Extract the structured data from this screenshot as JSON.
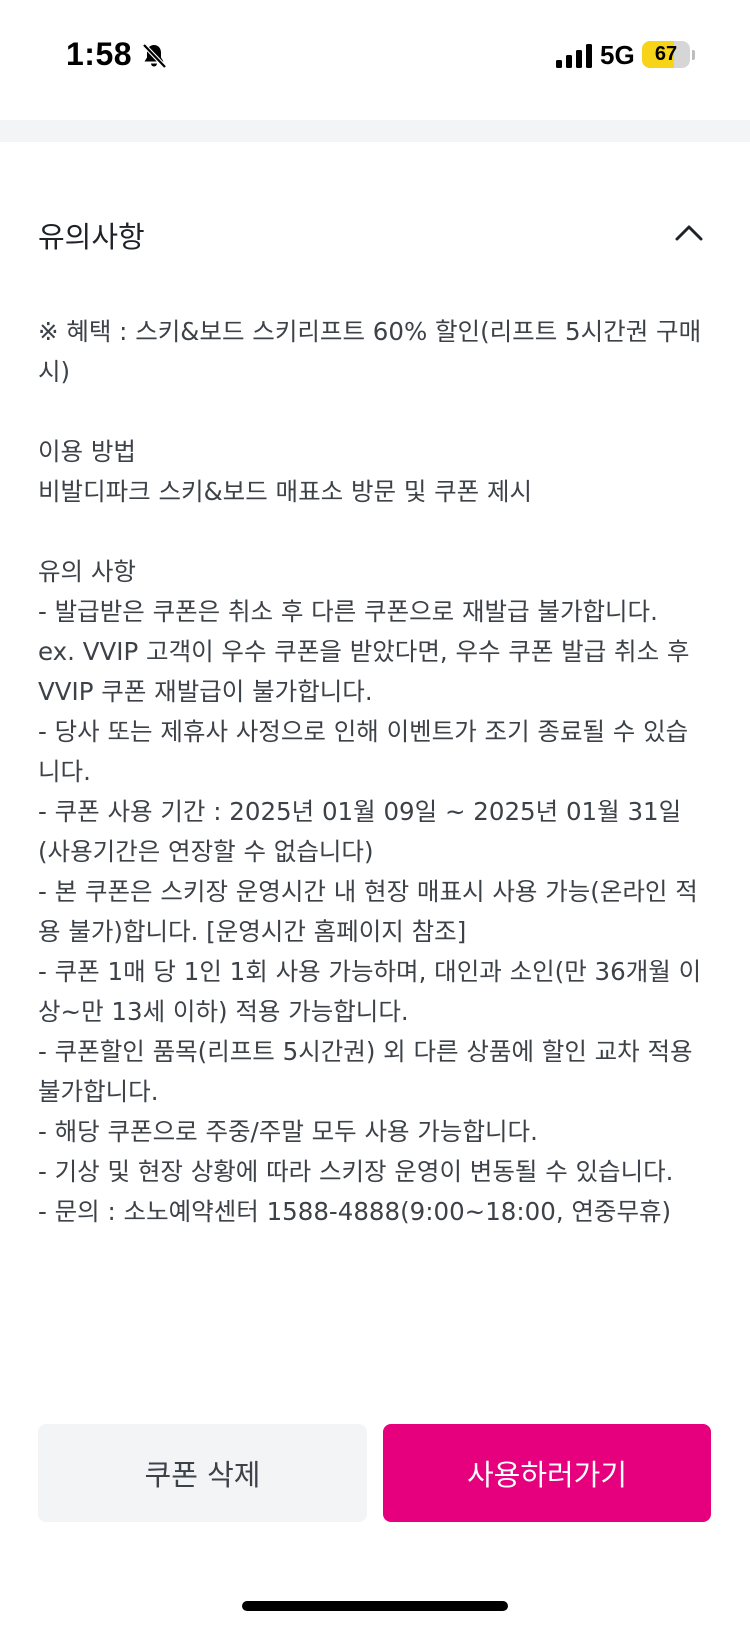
{
  "status_bar": {
    "time": "1:58",
    "network": "5G",
    "battery": "67",
    "battery_level": 0.67
  },
  "notice": {
    "title": "유의사항",
    "lines": [
      "※ 혜택 : 스키&보드 스키리프트 60% 할인(리프트 5시간권 구매",
      "시)",
      "",
      "이용 방법",
      "비발디파크 스키&보드 매표소 방문 및 쿠폰 제시",
      "",
      "유의 사항",
      "- 발급받은 쿠폰은 취소 후 다른 쿠폰으로 재발급 불가합니다.",
      "ex. VVIP 고객이 우수 쿠폰을 받았다면, 우수 쿠폰 발급 취소 후",
      "VVIP 쿠폰 재발급이 불가합니다.",
      "- 당사 또는 제휴사 사정으로 인해 이벤트가 조기 종료될 수 있습",
      "니다.",
      "- 쿠폰 사용 기간 : 2025년 01월 09일 ~ 2025년 01월 31일",
      "(사용기간은 연장할 수 없습니다)",
      "- 본 쿠폰은 스키장 운영시간 내 현장 매표시 사용 가능(온라인 적",
      "용 불가)합니다. [운영시간 홈페이지 참조]",
      "- 쿠폰 1매 당 1인 1회 사용 가능하며, 대인과 소인(만 36개월 이",
      "상~만 13세 이하) 적용 가능합니다.",
      "- 쿠폰할인 품목(리프트 5시간권) 외 다른 상품에 할인 교차 적용",
      "불가합니다.",
      "- 해당 쿠폰으로 주중/주말 모두 사용 가능합니다.",
      "- 기상 및 현장 상황에 따라 스키장 운영이 변동될 수 있습니다.",
      "- 문의 : 소노예약센터 1588-4888(9:00~18:00, 연중무휴)"
    ]
  },
  "buttons": {
    "delete_label": "쿠폰 삭제",
    "use_label": "사용하러가기"
  },
  "colors": {
    "accent": "#e6007e",
    "secondary_button": "#f3f4f6",
    "text": "#3d4249"
  }
}
